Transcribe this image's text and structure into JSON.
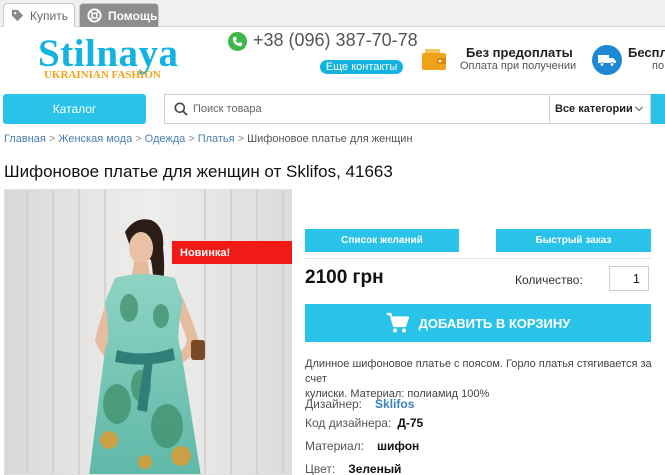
{
  "top_tabs": {
    "buy": "Купить",
    "help": "Помощь"
  },
  "logo": {
    "name": "Stilnaya",
    "tagline": "UKRAINIAN FASHION"
  },
  "phone": {
    "number": "+38 (096) 387-70-78",
    "contacts_button": "Еще контакты"
  },
  "prepay": {
    "title": "Без предоплаты",
    "subtitle": "Оплата при получении"
  },
  "delivery": {
    "title": "Беспл",
    "subtitle": "по"
  },
  "nav": {
    "catalog_button": "Каталог",
    "search_placeholder": "Поиск товара",
    "category_select": "Все категории"
  },
  "breadcrumb": {
    "items": [
      "Главная",
      "Женская мода",
      "Одежда",
      "Платья"
    ],
    "current": "Шифоновое платье для женщин",
    "separator": ">"
  },
  "product": {
    "title": "Шифоновое платье для женщин от Sklifos, 41663",
    "badge": "Новинка!",
    "wishlist_button": "Список желаний",
    "quick_order_button": "Быстрый заказ",
    "price": "2100 грн",
    "quantity_label": "Количество:",
    "quantity_value": "1",
    "add_to_cart": "ДОБАВИТЬ В КОРЗИНУ",
    "description_line1": "Длинное шифоновое платье с поясом. Горло платья стягивается за счет",
    "description_line2": "кулиски.   Материал: полиамид 100%",
    "specs": [
      {
        "label": "Дизайнер:",
        "value": "Sklifos"
      },
      {
        "label": "Код дизайнера:",
        "value": "Д-75"
      },
      {
        "label": "Материал:",
        "value": "шифон"
      },
      {
        "label": "Цвет:",
        "value": "Зеленый"
      }
    ]
  },
  "icons": {
    "tag": "tag-icon",
    "lifebuoy": "lifebuoy-icon",
    "phone": "phone-icon",
    "wallet": "wallet-icon",
    "truck": "truck-icon",
    "search": "search-icon",
    "chevron": "chevron-down-icon",
    "cart": "cart-icon"
  },
  "colors": {
    "accent": "#29c3ea",
    "logo": "#12b3e0",
    "tagline": "#f0a218",
    "badge": "#f01a16",
    "phone_icon": "#3db64a",
    "truck_icon": "#1e88d2"
  }
}
